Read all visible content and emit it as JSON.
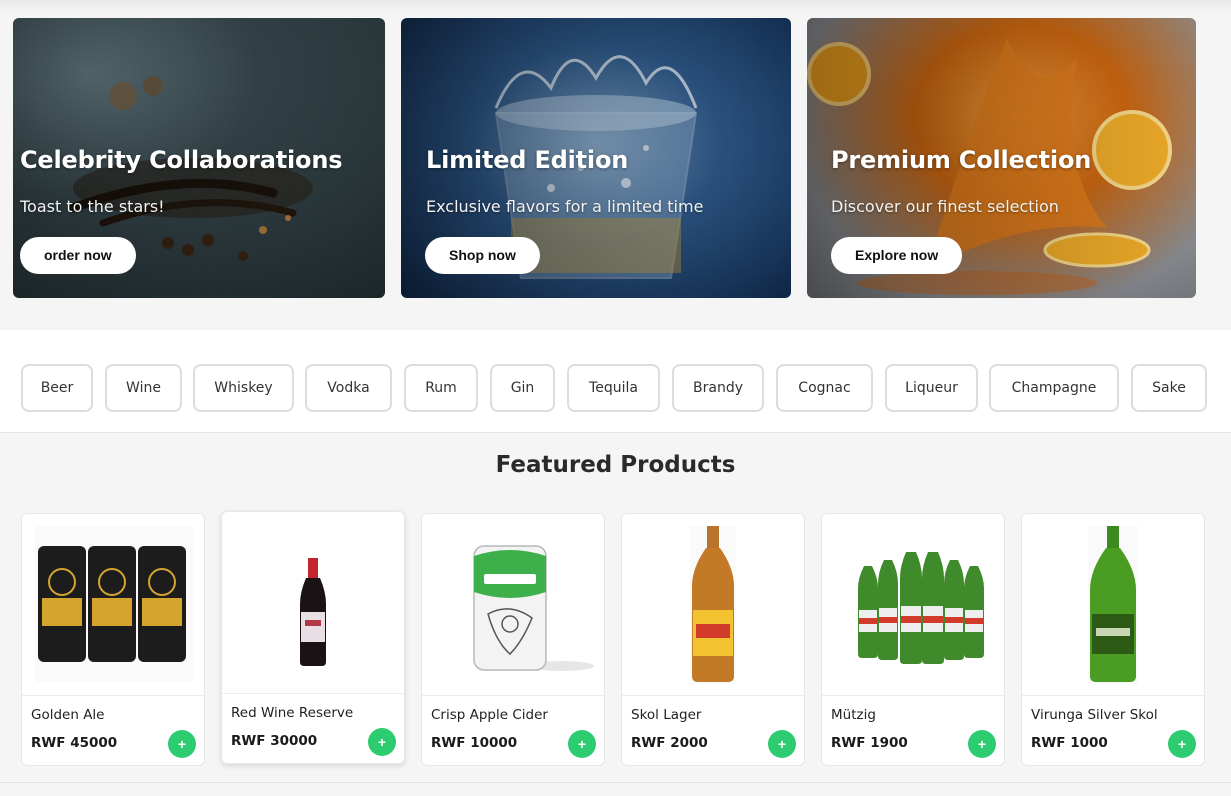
{
  "hero": [
    {
      "title": "Celebrity Collaborations",
      "subtitle": "Toast to the stars!",
      "button": "order now"
    },
    {
      "title": "Limited Edition",
      "subtitle": "Exclusive flavors for a limited time",
      "button": "Shop now"
    },
    {
      "title": "Premium Collection",
      "subtitle": "Discover our finest selection",
      "button": "Explore now"
    }
  ],
  "categories": [
    "Beer",
    "Wine",
    "Whiskey",
    "Vodka",
    "Rum",
    "Gin",
    "Tequila",
    "Brandy",
    "Cognac",
    "Liqueur",
    "Champagne",
    "Sake"
  ],
  "featured": {
    "title": "Featured Products",
    "add_label": "+",
    "products": [
      {
        "name": "Golden Ale",
        "price": "RWF 45000"
      },
      {
        "name": "Red Wine Reserve",
        "price": "RWF 30000"
      },
      {
        "name": "Crisp Apple Cider",
        "price": "RWF 10000"
      },
      {
        "name": "Skol Lager",
        "price": "RWF 2000"
      },
      {
        "name": "Mützig",
        "price": "RWF 1900"
      },
      {
        "name": "Virunga Silver Skol",
        "price": "RWF 1000"
      }
    ]
  },
  "colors": {
    "accent_green": "#2ecc71",
    "chip_border": "#dcdcdc",
    "page_bg": "#f5f5f5"
  }
}
